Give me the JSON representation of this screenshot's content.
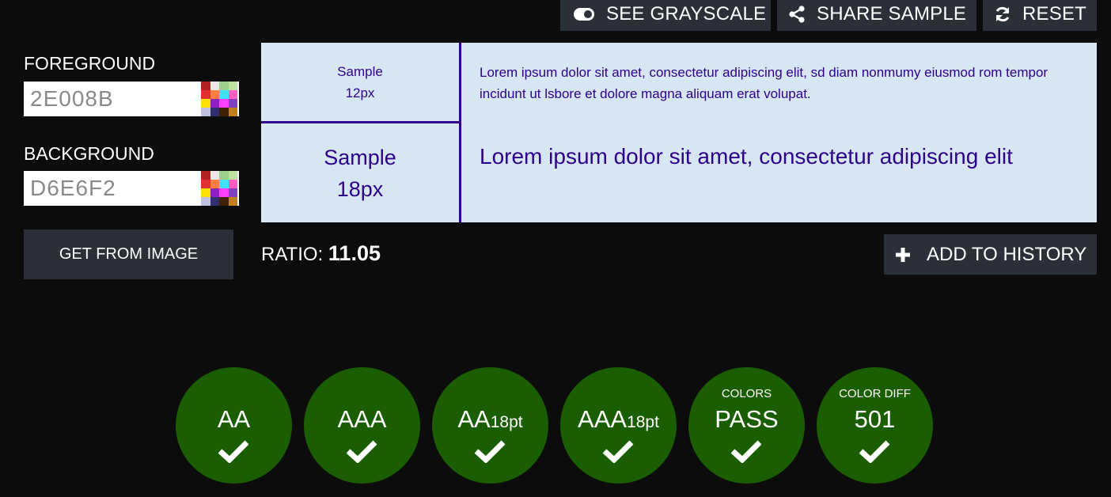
{
  "toolbar": {
    "grayscale_label": "SEE GRAYSCALE",
    "share_label": "SHARE SAMPLE",
    "reset_label": "RESET"
  },
  "foreground": {
    "label": "FOREGROUND",
    "value": "2E008B"
  },
  "background": {
    "label": "BACKGROUND",
    "value": "D6E6F2"
  },
  "get_from_image_label": "GET FROM IMAGE",
  "sample": {
    "small_label_line1": "Sample",
    "small_label_line2": "12px",
    "large_label_line1": "Sample",
    "large_label_line2": "18px",
    "small_text": "Lorem ipsum dolor sit amet, consectetur adipiscing elit, sd diam nonmumy eiusmod rom tempor incidunt ut lsbore et dolore magna aliquam erat volupat.",
    "large_text": "Lorem ipsum dolor sit amet, consectetur adipiscing elit"
  },
  "ratio": {
    "label": "RATIO:",
    "value": "11.05"
  },
  "add_history_label": "ADD TO HISTORY",
  "results": [
    {
      "caption": "",
      "main": "AA",
      "suffix": ""
    },
    {
      "caption": "",
      "main": "AAA",
      "suffix": ""
    },
    {
      "caption": "",
      "main": "AA",
      "suffix": "18pt"
    },
    {
      "caption": "",
      "main": "AAA",
      "suffix": "18pt"
    },
    {
      "caption": "COLORS",
      "main": "PASS",
      "suffix": ""
    },
    {
      "caption": "COLOR DIFF",
      "main": "501",
      "suffix": ""
    }
  ],
  "colors": {
    "foreground": "#2E008B",
    "background": "#D6E6F2",
    "pass_green": "#1a5e00",
    "button_bg": "#2b3038"
  },
  "icons": {
    "grayscale": "toggle-icon",
    "share": "share-icon",
    "reset": "refresh-icon",
    "add": "plus-icon",
    "pass": "check-icon",
    "picker": "color-palette-icon"
  }
}
